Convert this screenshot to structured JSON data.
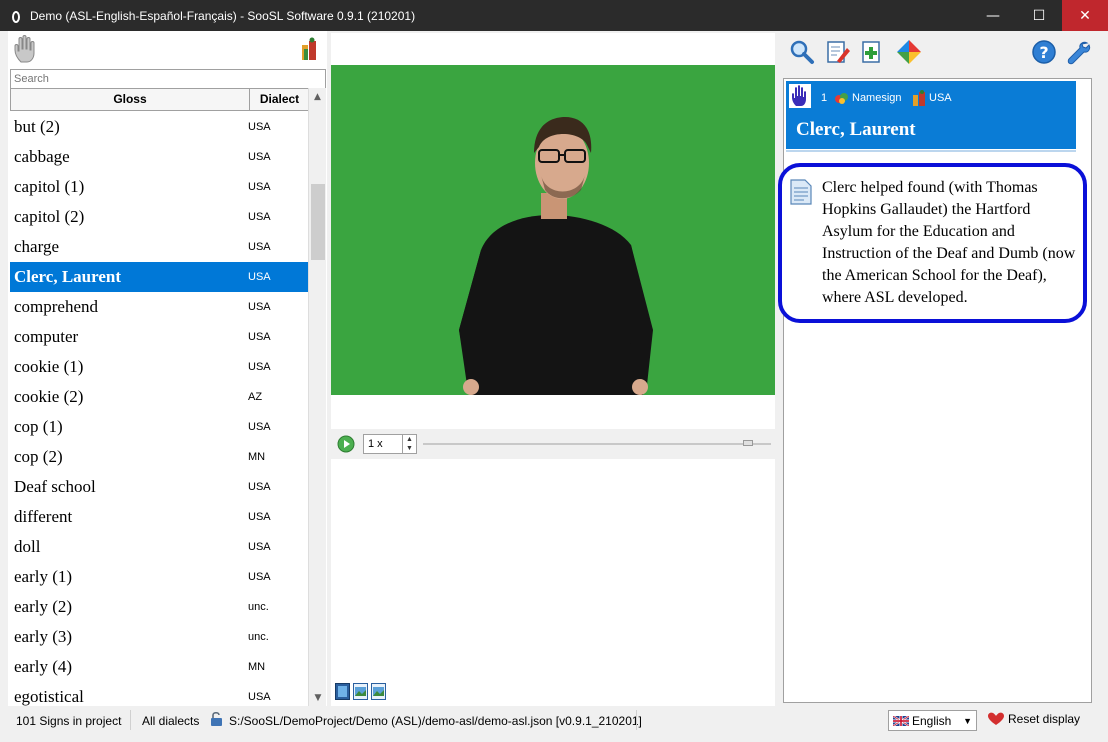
{
  "window": {
    "title": "Demo (ASL-English-Español-Français) - SooSL Software 0.9.1 (210201)",
    "minimize": "—",
    "maximize": "☐",
    "close": "✕"
  },
  "left_panel": {
    "search_placeholder": "Search",
    "columns": {
      "gloss": "Gloss",
      "dialect": "Dialect"
    },
    "rows": [
      {
        "gloss": "but (2)",
        "dialect": "USA"
      },
      {
        "gloss": "cabbage",
        "dialect": "USA"
      },
      {
        "gloss": "capitol (1)",
        "dialect": "USA"
      },
      {
        "gloss": "capitol (2)",
        "dialect": "USA"
      },
      {
        "gloss": "charge",
        "dialect": "USA"
      },
      {
        "gloss": "Clerc, Laurent",
        "dialect": "USA",
        "selected": true
      },
      {
        "gloss": "comprehend",
        "dialect": "USA"
      },
      {
        "gloss": "computer",
        "dialect": "USA"
      },
      {
        "gloss": "cookie (1)",
        "dialect": "USA"
      },
      {
        "gloss": "cookie (2)",
        "dialect": "AZ"
      },
      {
        "gloss": "cop (1)",
        "dialect": "USA"
      },
      {
        "gloss": "cop (2)",
        "dialect": "MN"
      },
      {
        "gloss": "Deaf school",
        "dialect": "USA"
      },
      {
        "gloss": "different",
        "dialect": "USA"
      },
      {
        "gloss": "doll",
        "dialect": "USA"
      },
      {
        "gloss": "early (1)",
        "dialect": "USA"
      },
      {
        "gloss": "early (2)",
        "dialect": "unc."
      },
      {
        "gloss": "early (3)",
        "dialect": "unc."
      },
      {
        "gloss": "early (4)",
        "dialect": "MN"
      },
      {
        "gloss": "egotistical",
        "dialect": "USA"
      }
    ]
  },
  "player": {
    "speed": "1 x"
  },
  "sense": {
    "number": "1",
    "grammar_category": "Namesign",
    "dialect": "USA",
    "gloss": "Clerc, Laurent",
    "note": "Clerc helped found (with Thomas Hopkins Gallaudet) the Hartford Asylum for the Education and Instruction of the Deaf and Dumb (now the American School for the Deaf), where ASL developed."
  },
  "status": {
    "sign_count": "101 Signs in project",
    "dialect_filter": "All dialects",
    "project_path": "S:/SooSL/DemoProject/Demo (ASL)/demo-asl/demo-asl.json [v0.9.1_210201]",
    "language": "English",
    "reset": "Reset display"
  },
  "colors": {
    "selection": "#0078d7",
    "sense_header": "#0a7cd6",
    "note_border": "#0a10d8",
    "video_bg": "#3aa540"
  }
}
